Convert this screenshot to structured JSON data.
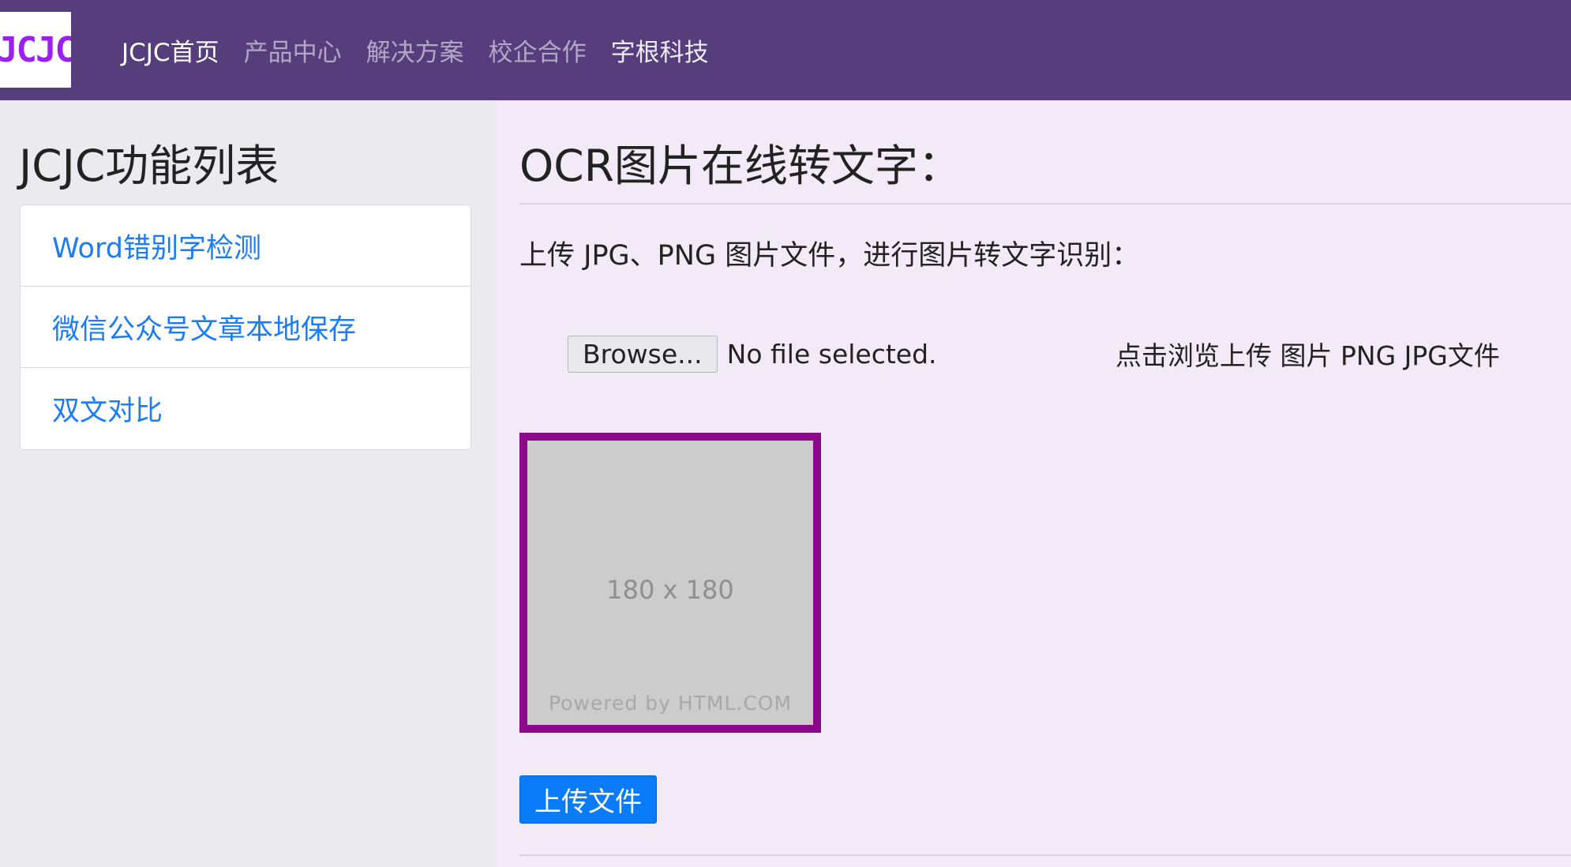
{
  "navbar": {
    "logo_text": "JCJC",
    "links": [
      {
        "label": "JCJC首页",
        "active": true
      },
      {
        "label": "产品中心",
        "active": false
      },
      {
        "label": "解决方案",
        "active": false
      },
      {
        "label": "校企合作",
        "active": false
      },
      {
        "label": "字根科技",
        "active": false
      }
    ],
    "background_color": "#563d7c"
  },
  "sidebar": {
    "title": "JCJC功能列表",
    "items": [
      {
        "label": "Word错别字检测"
      },
      {
        "label": "微信公众号文章本地保存"
      },
      {
        "label": "双文对比"
      }
    ],
    "link_color": "#1a7cf7"
  },
  "main": {
    "title": "OCR图片在线转文字：",
    "instruction": "上传 JPG、PNG 图片文件，进行图片转文字识别：",
    "file_input": {
      "button_label": "Browse...",
      "status": "No file selected."
    },
    "hint": "点击浏览上传 图片 PNG JPG文件",
    "preview": {
      "size_label": "180 x 180",
      "credit": "Powered by HTML.COM",
      "border_color": "#8b0a8b"
    },
    "upload_button": {
      "label": "上传文件",
      "color": "#0a7bf9"
    }
  }
}
